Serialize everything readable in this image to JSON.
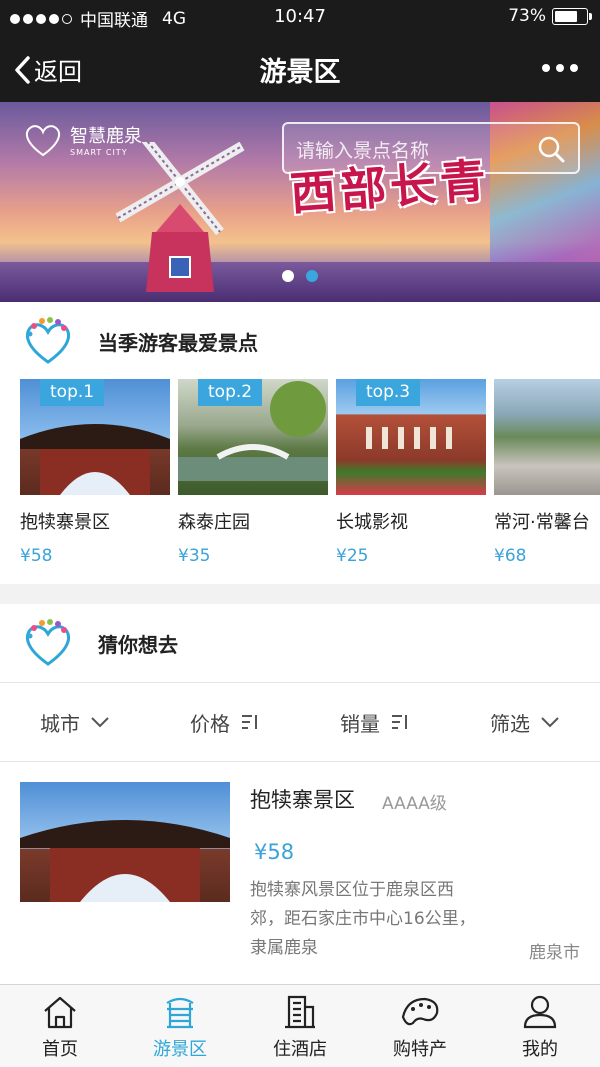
{
  "status": {
    "carrier": "中国联通",
    "network": "4G",
    "time": "10:47",
    "battery": "73%",
    "battery_level": 0.73
  },
  "navbar": {
    "back_label": "返回",
    "title": "游景区"
  },
  "banner": {
    "logo_name": "智慧鹿泉",
    "logo_sub": "SMART CITY",
    "search_placeholder": "请输入景点名称",
    "slogan": "西部长青"
  },
  "featured": {
    "title": "当季游客最爱景点",
    "items": [
      {
        "badge": "top.1",
        "name": "抱犊寨景区",
        "price": "¥58"
      },
      {
        "badge": "top.2",
        "name": "森泰庄园",
        "price": "¥35"
      },
      {
        "badge": "top.3",
        "name": "长城影视",
        "price": "¥25"
      },
      {
        "badge": "",
        "name": "常河·常馨台",
        "price": "¥68"
      }
    ]
  },
  "guess": {
    "title": "猜你想去",
    "filters": [
      {
        "label": "城市",
        "icon": "chevron-down-icon"
      },
      {
        "label": "价格",
        "icon": "sort-icon"
      },
      {
        "label": "销量",
        "icon": "sort-icon"
      },
      {
        "label": "筛选",
        "icon": "chevron-down-icon"
      }
    ],
    "listing": {
      "name": "抱犊寨景区",
      "grade": "AAAA级",
      "price": "¥58",
      "description": "抱犊寨风景区位于鹿泉区西郊，距石家庄市中心16公里，隶属鹿泉",
      "location": "鹿泉市"
    }
  },
  "tabbar": {
    "items": [
      {
        "label": "首页",
        "icon": "home-icon"
      },
      {
        "label": "游景区",
        "icon": "scenic-icon",
        "active": true
      },
      {
        "label": "住酒店",
        "icon": "hotel-icon"
      },
      {
        "label": "购特产",
        "icon": "shopping-icon"
      },
      {
        "label": "我的",
        "icon": "user-icon"
      }
    ]
  },
  "colors": {
    "accent": "#2ea7d8",
    "dark_bar": "#1b1b1b",
    "badge": "#3ba6dd"
  }
}
